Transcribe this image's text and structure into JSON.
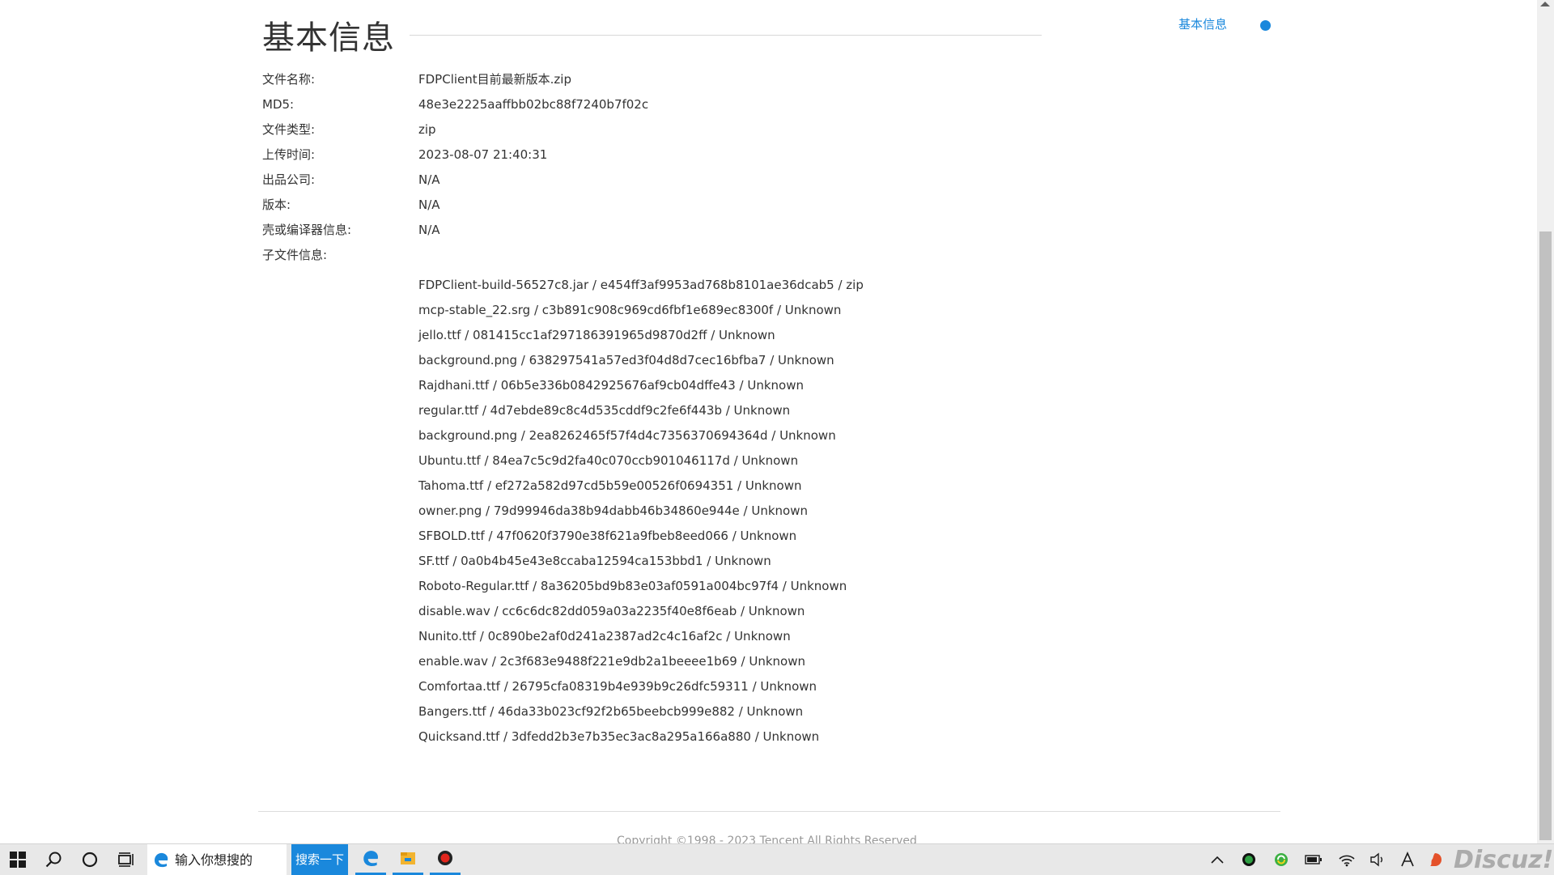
{
  "section": {
    "title": "基本信息"
  },
  "side_nav": {
    "link_label": "基本信息",
    "accent_color": "#1a88dc"
  },
  "info_rows": [
    {
      "label": "文件名称:",
      "value": "FDPClient目前最新版本.zip"
    },
    {
      "label": "MD5:",
      "value": "48e3e2225aaffbb02bc88f7240b7f02c"
    },
    {
      "label": "文件类型:",
      "value": "zip"
    },
    {
      "label": "上传时间:",
      "value": "2023-08-07 21:40:31"
    },
    {
      "label": "出品公司:",
      "value": "N/A"
    },
    {
      "label": "版本:",
      "value": "N/A"
    },
    {
      "label": "壳或编译器信息:",
      "value": "N/A"
    },
    {
      "label": "子文件信息:",
      "value": ""
    }
  ],
  "sub_files": [
    "FDPClient-build-56527c8.jar / e454ff3af9953ad768b8101ae36dcab5 / zip",
    "mcp-stable_22.srg / c3b891c908c969cd6fbf1e689ec8300f / Unknown",
    "jello.ttf / 081415cc1af297186391965d9870d2ff / Unknown",
    "background.png / 638297541a57ed3f04d8d7cec16bfba7 / Unknown",
    "Rajdhani.ttf / 06b5e336b0842925676af9cb04dffe43 / Unknown",
    "regular.ttf / 4d7ebde89c8c4d535cddf9c2fe6f443b / Unknown",
    "background.png / 2ea8262465f57f4d4c7356370694364d / Unknown",
    "Ubuntu.ttf / 84ea7c5c9d2fa40c070ccb901046117d / Unknown",
    "Tahoma.ttf / ef272a582d97cd5b59e00526f0694351 / Unknown",
    "owner.png / 79d99946da38b94dabb46b34860e944e / Unknown",
    "SFBOLD.ttf / 47f0620f3790e38f621a9fbeb8eed066 / Unknown",
    "SF.ttf / 0a0b4b45e43e8ccaba12594ca153bbd1 / Unknown",
    "Roboto-Regular.ttf / 8a36205bd9b83e03af0591a004bc97f4 / Unknown",
    "disable.wav / cc6c6dc82dd059a03a2235f40e8f6eab / Unknown",
    "Nunito.ttf / 0c890be2af0d241a2387ad2c4c16af2c / Unknown",
    "enable.wav / 2c3f683e9488f221e9db2a1beeee1b69 / Unknown",
    "Comfortaa.ttf / 26795cfa08319b4e939b9c26dfc59311 / Unknown",
    "Bangers.ttf / 46da33b023cf92f2b65beebcb999e882 / Unknown",
    "Quicksand.ttf / 3dfedd2b3e7b35ec3ac8a295a166a880 / Unknown"
  ],
  "footer": {
    "copyright": "Copyright ©1998 - 2023 Tencent All Rights Reserved"
  },
  "taskbar": {
    "search_placeholder": "输入你想搜的",
    "search_button": "搜索一下",
    "watermark": "Discuz!",
    "icons": [
      "windows-start-icon",
      "search-icon",
      "cortana-icon",
      "task-view-icon",
      "edge-icon",
      "file-explorer-icon",
      "record-app-icon"
    ],
    "tray_icons": [
      "show-hidden-icons-chevron",
      "status-green-icon",
      "sync-icon",
      "battery-icon",
      "wifi-icon",
      "volume-icon",
      "ime-icon",
      "security-app-icon"
    ]
  }
}
